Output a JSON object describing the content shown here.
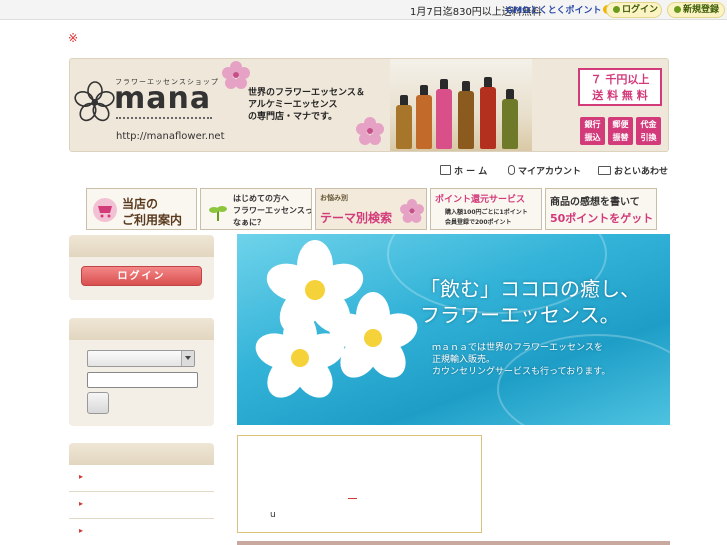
{
  "topbar": {
    "notice": "1月7日迄830円以上送料無料",
    "gmo_label": "GMOとくとくポイント",
    "login_label": "ログイン",
    "register_label": "新規登録"
  },
  "marker": "※",
  "banner": {
    "shop_sub": "フラワーエッセンスショップ",
    "brand": "mana",
    "url": "http://manaflower.net",
    "tagline_1": "世界のフラワーエッセンス＆",
    "tagline_2": "アルケミーエッセンス",
    "tagline_3": "の専門店・マナです。",
    "shipping_1": "７ 千円以上",
    "shipping_2": "送 料 無 料",
    "pay": [
      {
        "l1": "銀行",
        "l2": "振込"
      },
      {
        "l1": "郵便",
        "l2": "振替"
      },
      {
        "l1": "代金",
        "l2": "引換"
      }
    ]
  },
  "nav": {
    "home": "ホ ー ム",
    "account": "マイアカウント",
    "contact": "おといあわせ"
  },
  "categories": {
    "c1_a": "当店の",
    "c1_b": "ご利用案内",
    "c2_a": "はじめての方へ",
    "c2_b": "フラワーエッセンスって",
    "c2_c": "なぁに？",
    "c3_a": "お悩み別",
    "c3_b": "テーマ別検索",
    "c4_a": "ポイント還元サービス",
    "c4_b": "購入額100円ごとに1ポイント",
    "c4_c": "会員登録で200ポイント",
    "c5_a": "商品の感想を書いて",
    "c5_b": "50ポイントをゲット"
  },
  "sidebar": {
    "login_button": "ログイン"
  },
  "hero": {
    "headline_1": "「飲む」ココロの癒し、",
    "headline_2": "フラワーエッセンス。",
    "sub_1": "ｍａｎａでは世界のフラワーエッセンスを",
    "sub_2": "正規輸入販売。",
    "sub_3": "カウンセリングサービスも行っております。"
  },
  "info": {
    "u_text": "u"
  },
  "colors": {
    "accent_pink": "#d23a7a",
    "login_red": "#d94f4f",
    "water": "#33b3d8"
  }
}
